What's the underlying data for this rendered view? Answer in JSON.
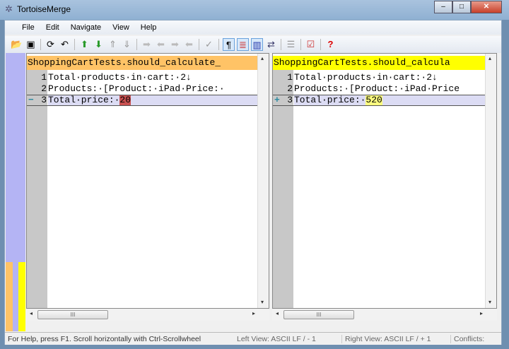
{
  "window": {
    "title": "TortoiseMerge",
    "controls": [
      "minimize",
      "maximize",
      "close"
    ]
  },
  "menu": [
    "File",
    "Edit",
    "Navigate",
    "View",
    "Help"
  ],
  "toolbar": [
    {
      "icon": "open-icon",
      "glyph": "📂"
    },
    {
      "icon": "save-icon",
      "glyph": "▣"
    },
    "sep",
    {
      "icon": "reload-icon",
      "glyph": "⟳"
    },
    {
      "icon": "undo-icon",
      "glyph": "↶"
    },
    "sep",
    {
      "icon": "prev-difference-icon",
      "glyph": "⬆",
      "color": "#2a9a2a"
    },
    {
      "icon": "next-difference-icon",
      "glyph": "⬇",
      "color": "#2a9a2a"
    },
    {
      "icon": "prev-conflict-icon",
      "glyph": "⇑",
      "color": "#999"
    },
    {
      "icon": "next-conflict-icon",
      "glyph": "⇓",
      "color": "#999"
    },
    "sep",
    {
      "icon": "use-right-icon",
      "glyph": "➡",
      "color": "#bbb"
    },
    {
      "icon": "use-left-icon",
      "glyph": "⬅",
      "color": "#bbb"
    },
    {
      "icon": "use-right-block-icon",
      "glyph": "➡",
      "color": "#bbb"
    },
    {
      "icon": "use-left-block-icon",
      "glyph": "⬅",
      "color": "#bbb"
    },
    "sep",
    {
      "icon": "mark-resolved-icon",
      "glyph": "✓",
      "color": "#999"
    },
    "sep",
    {
      "icon": "whitespace-icon",
      "glyph": "¶",
      "on": true
    },
    {
      "icon": "inline-diff-icon",
      "glyph": "≣",
      "on": true,
      "color": "#c33"
    },
    {
      "icon": "side-by-side-icon",
      "glyph": "▥",
      "on": true,
      "color": "#23a"
    },
    {
      "icon": "switch-views-icon",
      "glyph": "⇄",
      "color": "#336"
    },
    "sep",
    {
      "icon": "line-diff-icon",
      "glyph": "☰",
      "color": "#999"
    },
    "sep",
    {
      "icon": "settings-icon",
      "glyph": "☑",
      "color": "#c33"
    },
    "sep",
    {
      "icon": "help-icon",
      "glyph": "?",
      "color": "#d00"
    }
  ],
  "left": {
    "header": "ShoppingCartTests.should_calculate_",
    "header_color": "#ffc366",
    "lines": [
      {
        "num": "1",
        "text": "Total·products·in·cart:·2↓"
      },
      {
        "num": "2",
        "text": "Products:·[Product:·iPad·Price:·"
      },
      {
        "num": "3",
        "text": "Total·price:·",
        "hl": "20",
        "mark": "−"
      }
    ],
    "hl_color": "#c85050"
  },
  "right": {
    "header": "ShoppingCartTests.should_calcula",
    "header_color": "#ffff00",
    "lines": [
      {
        "num": "1",
        "text": "Total·products·in·cart:·2↓"
      },
      {
        "num": "2",
        "text": "Products:·[Product:·iPad·Price"
      },
      {
        "num": "3",
        "text": "Total·price:·",
        "hl": "520",
        "mark": "+"
      }
    ],
    "hl_color": "#ffff80"
  },
  "status": {
    "help": "For Help, press F1. Scroll horizontally with Ctrl-Scrollwheel",
    "left_view": "Left View: ASCII LF  / - 1",
    "right_view": "Right View: ASCII LF  / + 1",
    "conflicts": "Conflicts: "
  }
}
